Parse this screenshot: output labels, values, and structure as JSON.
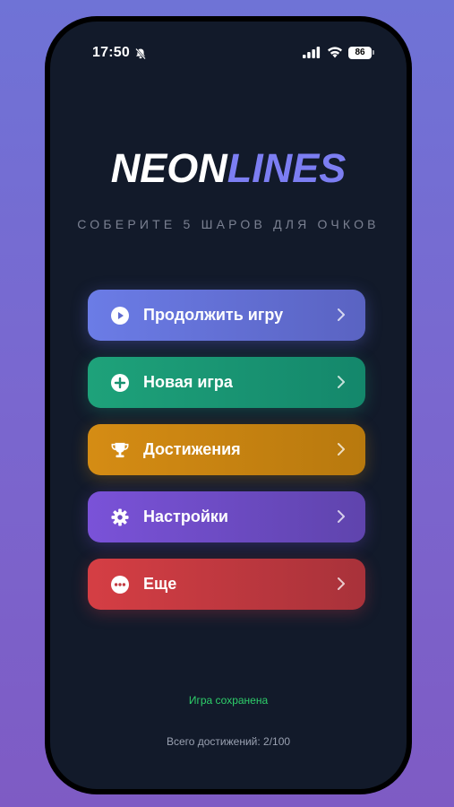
{
  "status_bar": {
    "time": "17:50",
    "battery": "86"
  },
  "logo": {
    "part1": "NEON",
    "part2": "LINES"
  },
  "subtitle": "СОБЕРИТЕ 5 ШАРОВ ДЛЯ ОЧКОВ",
  "menu": {
    "items": [
      {
        "label": "Продолжить игру",
        "icon": "play-circle-icon",
        "color": "#6b7ce6"
      },
      {
        "label": "Новая игра",
        "icon": "plus-circle-icon",
        "color": "#1ea27a"
      },
      {
        "label": "Достижения",
        "icon": "trophy-icon",
        "color": "#d58c14"
      },
      {
        "label": "Настройки",
        "icon": "gear-icon",
        "color": "#7a52d8"
      },
      {
        "label": "Еще",
        "icon": "more-circle-icon",
        "color": "#d53e44"
      }
    ]
  },
  "footer": {
    "saved_status": "Игра сохранена",
    "achievements_total": "Всего достижений: 2/100"
  }
}
